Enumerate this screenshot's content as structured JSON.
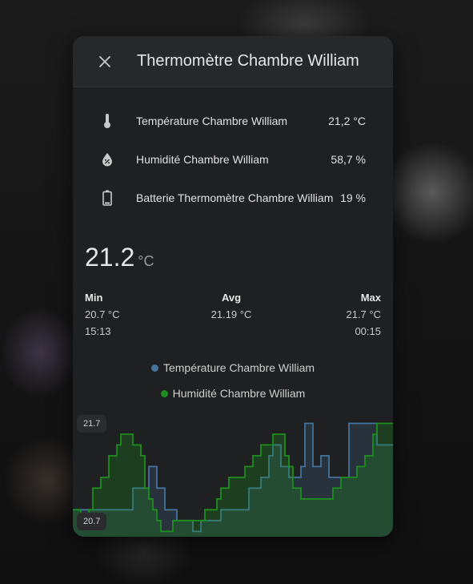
{
  "dialog": {
    "title": "Thermomètre Chambre William",
    "close_icon": "close-icon"
  },
  "entities": [
    {
      "icon": "thermometer-icon",
      "name": "Température Chambre William",
      "value": "21,2 °C"
    },
    {
      "icon": "water-percent-icon",
      "name": "Humidité Chambre William",
      "value": "58,7 %"
    },
    {
      "icon": "battery-icon",
      "name": "Batterie Thermomètre Chambre William",
      "value": "19 %"
    }
  ],
  "state": {
    "value": "21.2",
    "unit": "°C"
  },
  "stats": {
    "min": {
      "label": "Min",
      "value": "20.7 °C",
      "time": "15:13"
    },
    "avg": {
      "label": "Avg",
      "value": "21.19 °C"
    },
    "max": {
      "label": "Max",
      "value": "21.7 °C",
      "time": "00:15"
    }
  },
  "legend": [
    {
      "name": "Température Chambre William",
      "color": "#44739e"
    },
    {
      "name": "Humidité Chambre William",
      "color": "#1e8e1e"
    }
  ],
  "chart_data": {
    "type": "line",
    "y_ticks": [
      "21.7",
      "20.7"
    ],
    "ylim": [
      20.65,
      21.8
    ],
    "legend_position": "top",
    "series": [
      {
        "name": "Température Chambre William",
        "color": "#44739e",
        "step": true,
        "values": [
          20.9,
          20.9,
          20.9,
          20.9,
          20.9,
          20.9,
          20.9,
          20.9,
          20.9,
          20.9,
          20.9,
          20.9,
          20.9,
          20.9,
          20.9,
          21.1,
          21.1,
          21.1,
          21.1,
          21.3,
          21.3,
          21.1,
          21.1,
          20.9,
          20.9,
          20.9,
          20.8,
          20.8,
          20.8,
          20.8,
          20.7,
          20.7,
          20.8,
          20.8,
          20.8,
          20.8,
          20.8,
          20.9,
          20.9,
          20.9,
          20.9,
          20.9,
          20.9,
          20.9,
          21.1,
          21.1,
          21.1,
          21.2,
          21.2,
          21.4,
          21.5,
          21.5,
          21.3,
          21.3,
          21.2,
          21.2,
          21.2,
          21.3,
          21.7,
          21.7,
          21.3,
          21.3,
          21.4,
          21.4,
          21.2,
          21.2,
          21.2,
          21.2,
          21.2,
          21.7,
          21.7,
          21.7,
          21.7,
          21.7,
          21.7,
          21.7,
          21.5,
          21.5,
          21.5,
          21.5
        ]
      },
      {
        "name": "Humidité Chambre William",
        "color": "#1e8e1e",
        "step": true,
        "values": [
          20.9,
          20.9,
          20.8,
          20.8,
          20.9,
          21.1,
          21.1,
          21.2,
          21.2,
          21.4,
          21.4,
          21.5,
          21.6,
          21.6,
          21.6,
          21.5,
          21.5,
          21.4,
          21.1,
          21.0,
          20.9,
          20.8,
          20.7,
          20.7,
          20.7,
          20.8,
          20.8,
          20.8,
          20.8,
          20.8,
          20.8,
          20.8,
          20.8,
          20.9,
          20.9,
          20.9,
          21.0,
          21.1,
          21.1,
          21.2,
          21.2,
          21.2,
          21.2,
          21.3,
          21.3,
          21.4,
          21.4,
          21.5,
          21.5,
          21.5,
          21.6,
          21.6,
          21.6,
          21.4,
          21.3,
          21.1,
          21.1,
          21.0,
          21.0,
          21.0,
          21.0,
          21.0,
          21.0,
          21.0,
          21.0,
          21.1,
          21.1,
          21.2,
          21.2,
          21.2,
          21.2,
          21.3,
          21.3,
          21.4,
          21.4,
          21.6,
          21.7,
          21.7,
          21.7,
          21.7
        ]
      }
    ]
  }
}
